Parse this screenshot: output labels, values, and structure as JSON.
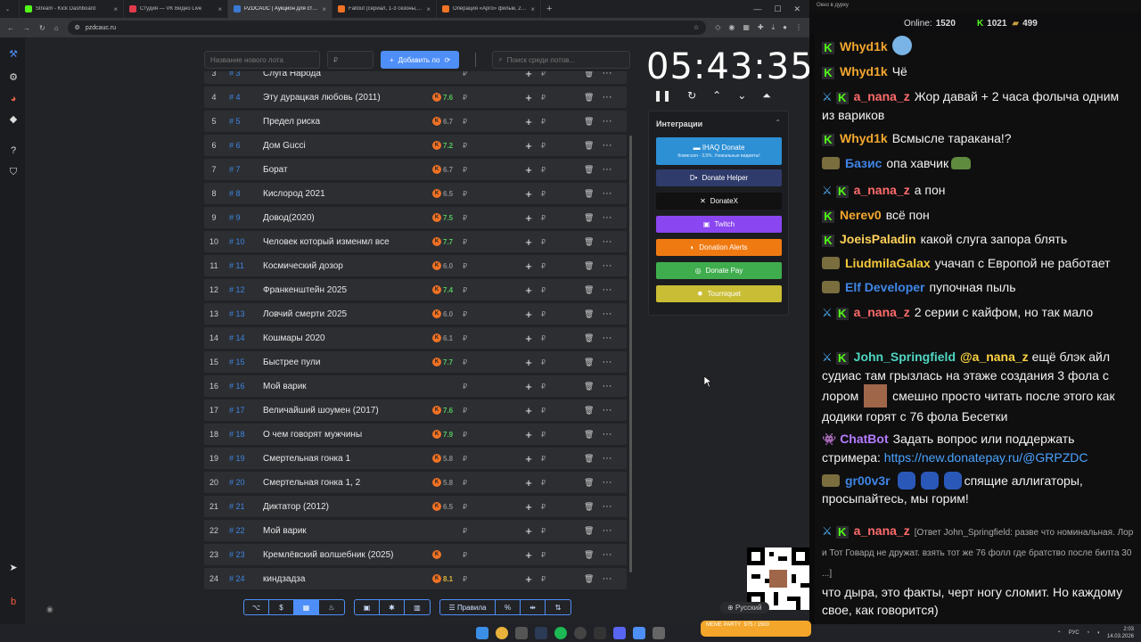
{
  "browser": {
    "tabs": [
      {
        "title": "Stream - Kick Dashboard",
        "color": "#53fc18",
        "active": false
      },
      {
        "title": "Студия — VK Видео Live",
        "color": "#e23b4b",
        "active": false
      },
      {
        "title": "PZDCAUC | Аукцион для стримеров",
        "color": "#3a7bd5",
        "active": true
      },
      {
        "title": "Fallout (сериал, 1-3 сезоны, все...",
        "color": "#f07224",
        "active": false
      },
      {
        "title": "Операция «Арго» фильм, 2012...",
        "color": "#f07224",
        "active": false
      }
    ],
    "url": "pzdcauc.ru"
  },
  "toolbar": {
    "lot_name_placeholder": "Название нового лота",
    "amount_placeholder": "₽",
    "add_label": "Добавить ло",
    "search_placeholder": "Поиск среди лотов..."
  },
  "lots": [
    {
      "idx": "3",
      "hash": "# 3",
      "name": "Слуга Народа",
      "rating": "",
      "rating_color": "#54c45e"
    },
    {
      "idx": "4",
      "hash": "# 4",
      "name": "Эту дурацкая любовь (2011)",
      "rating": "7.6",
      "rating_color": "#54c45e"
    },
    {
      "idx": "5",
      "hash": "# 5",
      "name": "Предел риска",
      "rating": "6.7",
      "rating_color": "#888888"
    },
    {
      "idx": "6",
      "hash": "# 6",
      "name": "Дом Gucci",
      "rating": "7.2",
      "rating_color": "#54c45e"
    },
    {
      "idx": "7",
      "hash": "# 7",
      "name": "Борат",
      "rating": "6.7",
      "rating_color": "#888888"
    },
    {
      "idx": "8",
      "hash": "# 8",
      "name": "Кислород 2021",
      "rating": "6.5",
      "rating_color": "#888888"
    },
    {
      "idx": "9",
      "hash": "# 9",
      "name": "Довод(2020)",
      "rating": "7.5",
      "rating_color": "#54c45e"
    },
    {
      "idx": "10",
      "hash": "# 10",
      "name": "Человек который изменмл все",
      "rating": "7.7",
      "rating_color": "#54c45e"
    },
    {
      "idx": "11",
      "hash": "# 11",
      "name": "Космический дозор",
      "rating": "6.0",
      "rating_color": "#888888"
    },
    {
      "idx": "12",
      "hash": "# 12",
      "name": "Франкенштейн 2025",
      "rating": "7.4",
      "rating_color": "#54c45e"
    },
    {
      "idx": "13",
      "hash": "# 13",
      "name": "Ловчий смерти 2025",
      "rating": "6.0",
      "rating_color": "#888888"
    },
    {
      "idx": "14",
      "hash": "# 14",
      "name": "Кошмары 2020",
      "rating": "6.1",
      "rating_color": "#888888"
    },
    {
      "idx": "15",
      "hash": "# 15",
      "name": "Быстрее пули",
      "rating": "7.7",
      "rating_color": "#54c45e"
    },
    {
      "idx": "16",
      "hash": "# 16",
      "name": "Мой варик",
      "rating": "",
      "rating_color": "#888888"
    },
    {
      "idx": "17",
      "hash": "# 17",
      "name": "Величайший шоумен (2017)",
      "rating": "7.6",
      "rating_color": "#54c45e"
    },
    {
      "idx": "18",
      "hash": "# 18",
      "name": "О чем говорят мужчины",
      "rating": "7.9",
      "rating_color": "#54c45e"
    },
    {
      "idx": "19",
      "hash": "# 19",
      "name": "Смертельная гонка 1",
      "rating": "5.8",
      "rating_color": "#888888"
    },
    {
      "idx": "20",
      "hash": "# 20",
      "name": "Смертельная гонка 1, 2",
      "rating": "5.8",
      "rating_color": "#888888"
    },
    {
      "idx": "21",
      "hash": "# 21",
      "name": "Диктатор (2012)",
      "rating": "6.5",
      "rating_color": "#888888"
    },
    {
      "idx": "22",
      "hash": "# 22",
      "name": "Мой варик",
      "rating": "",
      "rating_color": "#888888"
    },
    {
      "idx": "23",
      "hash": "# 23",
      "name": "Кремлёвский волшебник (2025)",
      "rating": "",
      "rating_color": "#888888"
    },
    {
      "idx": "24",
      "hash": "# 24",
      "name": "киндзадза",
      "rating": "8.1",
      "rating_color": "#d6b43c"
    }
  ],
  "currency": "₽",
  "timer": "05:43:35",
  "integrations": {
    "title": "Интеграции",
    "ihaq_label": "IHAQ Donate",
    "ihaq_sub": "Комиссия - 3,5%. Уникальные виджеты!",
    "buttons": [
      {
        "label": "Donate Helper",
        "color": "#2f3b6b",
        "icon": "D•"
      },
      {
        "label": "DonateX",
        "color": "#111111",
        "icon": "✕"
      },
      {
        "label": "Twitch",
        "color": "#8a46f0",
        "icon": "▣"
      },
      {
        "label": "Donation Alerts",
        "color": "#f07a12",
        "icon": "◐"
      },
      {
        "label": "Donate Pay",
        "color": "#3fad4d",
        "icon": "◎"
      },
      {
        "label": "Tourniquet",
        "color": "#c9bd35",
        "icon": "✸"
      }
    ]
  },
  "bottombar": {
    "rules_label": "Правила"
  },
  "lang": "Русский",
  "chat": {
    "window_title": "Окно в дурку",
    "online_label": "Online:",
    "online_count": "1520",
    "kick_count": "1021",
    "other_count": "499",
    "messages": [
      {
        "user": "Whyd1k",
        "color": "#f3a72e",
        "text": "",
        "emote": "round"
      },
      {
        "user": "Whyd1k",
        "color": "#f3a72e",
        "text": "Чё"
      },
      {
        "user": "a_nana_z",
        "color": "#ff6b6b",
        "text": "Жор давай + 2 часа фолыча одним из вариков",
        "sword": true
      },
      {
        "user": "Whyd1k",
        "color": "#f3a72e",
        "text": "Всмысле таракана!?"
      },
      {
        "user": "Базис",
        "color": "#3f86e6",
        "text": "опа хавчик",
        "hat": true,
        "frog": true
      },
      {
        "user": "a_nana_z",
        "color": "#ff6b6b",
        "text": "а пон",
        "sword": true
      },
      {
        "user": "Nerev0",
        "color": "#f3a72e",
        "text": "всё пон"
      },
      {
        "user": "JoeisPaladin",
        "color": "#ffd15a",
        "text": "какой слуга запора блять"
      },
      {
        "user": "LiudmilaGalax",
        "color": "#f4c93b",
        "text": "учачап с Европой не работает",
        "hat": true
      },
      {
        "user": "Elf Developer",
        "color": "#3f86e6",
        "text": "пупочная пыль",
        "hat": true
      },
      {
        "user": "a_nana_z",
        "color": "#ff6b6b",
        "text": "2 серии с кайфом, но так мало",
        "sword": true
      },
      {
        "user": "John_Springfield",
        "color": "#4fd6c0",
        "mention": "@a_nana_z",
        "text": "ещё блэк айл судиас там грызлась на этаже создания 3 фола с лором",
        "text2": "смешно просто читать после этого как додики горят с 76 фола Бесетки",
        "sword": true
      },
      {
        "user": "ChatBot",
        "color": "#b57cff",
        "text": "Задать вопрос или поддержать стримера:",
        "link": "https://new.donatepay.ru/@GRPZDC"
      },
      {
        "user": "gr00v3r",
        "color": "#3f86e6",
        "text": "спящие аллигаторы, просыпайтесь, мы горим!",
        "hat": true
      },
      {
        "user": "a_nana_z",
        "color": "#ff6b6b",
        "reply": "[Ответ John_Springfield: разве что номинальная. Лор и Тот Говард не дружат. взять тот же 76 фолл где братство после билта 30 ...]",
        "text": "что дыра, это факты, черт ногу сломит. Но каждому свое, как говорится)",
        "sword": true
      }
    ]
  },
  "memeparty": {
    "label": "MEME PARTY",
    "count": "975 / 1500"
  },
  "tray": {
    "lang": "РУС",
    "time": "2:03",
    "date": "14.03.2026"
  }
}
